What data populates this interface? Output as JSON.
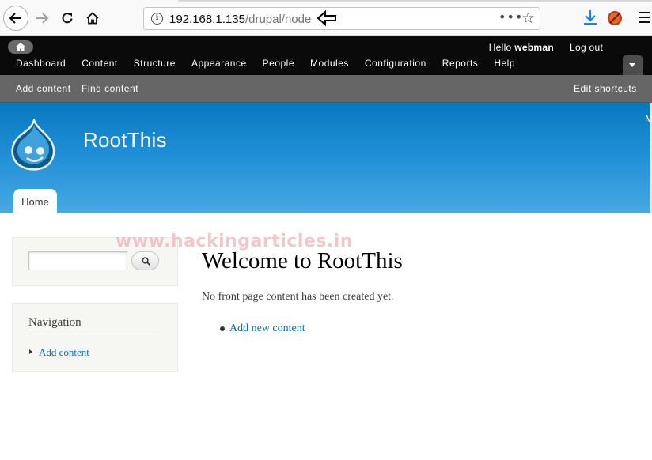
{
  "browser": {
    "url_host": "192.168.1.135",
    "url_path": "/drupal/node",
    "more_label": "•••"
  },
  "admin_toolbar": {
    "greeting_prefix": "Hello",
    "username": "webman",
    "logout": "Log out",
    "menu": [
      "Dashboard",
      "Content",
      "Structure",
      "Appearance",
      "People",
      "Modules",
      "Configuration",
      "Reports",
      "Help"
    ]
  },
  "shortcuts": {
    "items": [
      "Add content",
      "Find content"
    ],
    "edit": "Edit shortcuts"
  },
  "header": {
    "site_name": "RootThis",
    "corner_text": "M",
    "tabs": [
      "Home"
    ]
  },
  "sidebar": {
    "search_value": "",
    "navigation": {
      "title": "Navigation",
      "items": [
        "Add content"
      ]
    }
  },
  "main": {
    "watermark": "www.hackingarticles.in",
    "title": "Welcome to RootThis",
    "intro": "No front page content has been created yet.",
    "links": [
      "Add new content"
    ]
  },
  "colors": {
    "header_blue": "#0779bf",
    "link_blue": "#0071b3",
    "admin_black": "#0a0a0a",
    "shortcut_gray": "#666666"
  }
}
